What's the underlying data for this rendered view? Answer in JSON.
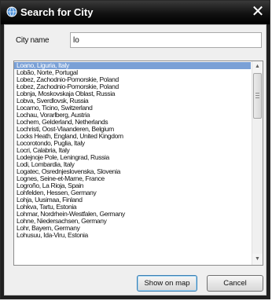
{
  "window": {
    "title": "Search for City",
    "close_glyph": "✕",
    "icon": "globe-icon"
  },
  "search": {
    "label": "City name",
    "value": "lo"
  },
  "results": [
    "Loano, Liguria, Italy",
    "Lobão, Norte, Portugal",
    "Lobez, Zachodnio-Pomorskie, Poland",
    "Łobez, Zachodnio-Pomorskie, Poland",
    "Lobnja, Moskovskaja Oblast, Russia",
    "Lobva, Sverdlovsk, Russia",
    "Locarno, Ticino, Switzerland",
    "Lochau, Vorarlberg, Austria",
    "Lochem, Gelderland, Netherlands",
    "Lochristi, Oost-Vlaanderen, Belgium",
    "Locks Heath, England, United Kingdom",
    "Locorotondo, Puglia, Italy",
    "Locri, Calabria, Italy",
    "Lodejnoje Pole, Leningrad, Russia",
    "Lodi, Lombardia, Italy",
    "Logatec, Osrednjeslovenska, Slovenia",
    "Lognes, Seine-et-Marne, France",
    "Logroño, La Rioja, Spain",
    "Lohfelden, Hessen, Germany",
    "Lohja, Uusimaa, Finland",
    "Lohkva, Tartu, Estonia",
    "Lohmar, Nordrhein-Westfalen, Germany",
    "Lohne, Niedersachsen, Germany",
    "Lohr, Bayern, Germany",
    "Lohusuu, Ida-Viru, Estonia"
  ],
  "selected_index": 0,
  "scrollbar": {
    "up_glyph": "▲",
    "down_glyph": "▼"
  },
  "buttons": {
    "show_on_map": "Show on map",
    "cancel": "Cancel"
  },
  "colors": {
    "selection": "#7aa0d6",
    "titlebar": "#000000"
  }
}
